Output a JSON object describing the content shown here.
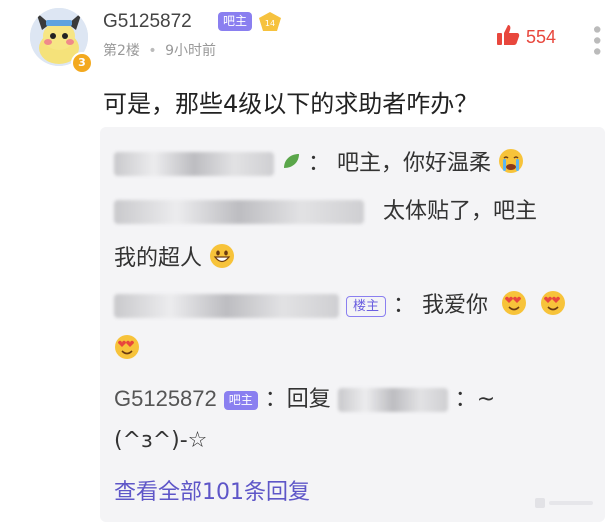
{
  "post": {
    "username": "G5125872",
    "owner_tag": "吧主",
    "level_badge": "14",
    "avatar_level": "3",
    "floor": "第2楼",
    "dot": "•",
    "time": "9小时前",
    "like_count": "554",
    "content": "可是，那些4级以下的求助者咋办？"
  },
  "replies": [
    {
      "sep": "：",
      "text": "吧主，你好温柔",
      "emoji": "crying-face"
    },
    {
      "text": "太体贴了，吧主",
      "text2": "我的超人",
      "emoji": "grinning-face"
    },
    {
      "tag": "楼主",
      "sep": "：",
      "text": "我爱你",
      "emoji": "heart-eyes-face"
    },
    {
      "user": "G5125872",
      "tag": "吧主",
      "text": "：回复",
      "text_end": "：~",
      "text2": "(^з^)-☆"
    }
  ],
  "view_all": "查看全部101条回复",
  "colors": {
    "accent": "#8a7ff0",
    "like": "#e8473d",
    "link": "#5e56c8"
  }
}
